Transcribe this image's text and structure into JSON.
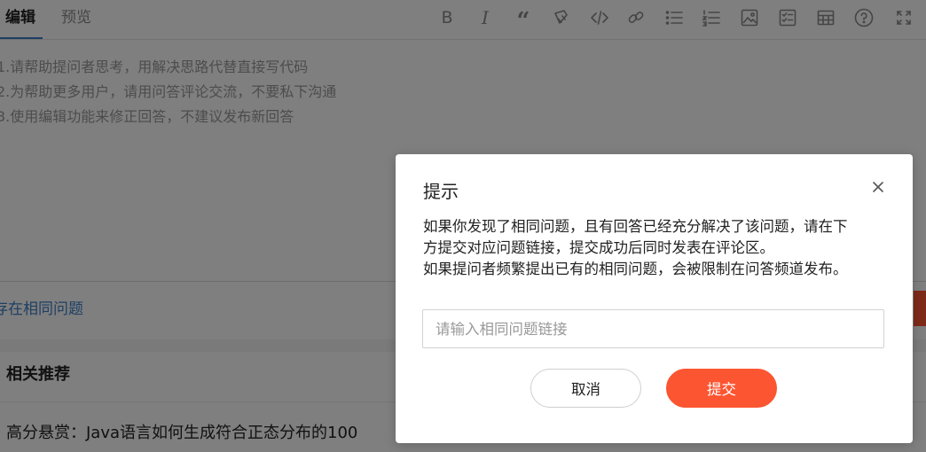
{
  "editor": {
    "tabs": [
      {
        "label": "编辑",
        "active": true
      },
      {
        "label": "预览",
        "active": false
      }
    ],
    "toolbar_icons": [
      "bold-icon",
      "italic-icon",
      "quote-icon",
      "eraser-icon",
      "code-icon",
      "link-icon",
      "unordered-list-icon",
      "ordered-list-icon",
      "image-icon",
      "template-icon",
      "table-icon",
      "help-icon",
      "fullscreen-icon"
    ],
    "placeholder_lines": [
      "1.请帮助提问者思考，用解决思路代替直接写代码",
      "2.为帮助更多用户，请用问答评论交流，不要私下沟通",
      "3.使用编辑功能来修正回答，不建议发布新回答"
    ],
    "accent_color": "#3d7fc7"
  },
  "same_question_link": "存在相同问题",
  "recommend": {
    "title": "相关推荐",
    "first_item": "高分悬赏：Java语言如何生成符合正态分布的100"
  },
  "dialog": {
    "title": "提示",
    "body_lines": [
      "如果你发现了相同问题，且有回答已经充分解决了该问题，请在下",
      "方提交对应问题链接，提交成功后同时发表在评论区。",
      "如果提问者频繁提出已有的相同问题，会被限制在问答频道发布。"
    ],
    "input_placeholder": "请输入相同问题链接",
    "input_value": "",
    "cancel_label": "取消",
    "submit_label": "提交",
    "submit_color": "#fc5531"
  }
}
